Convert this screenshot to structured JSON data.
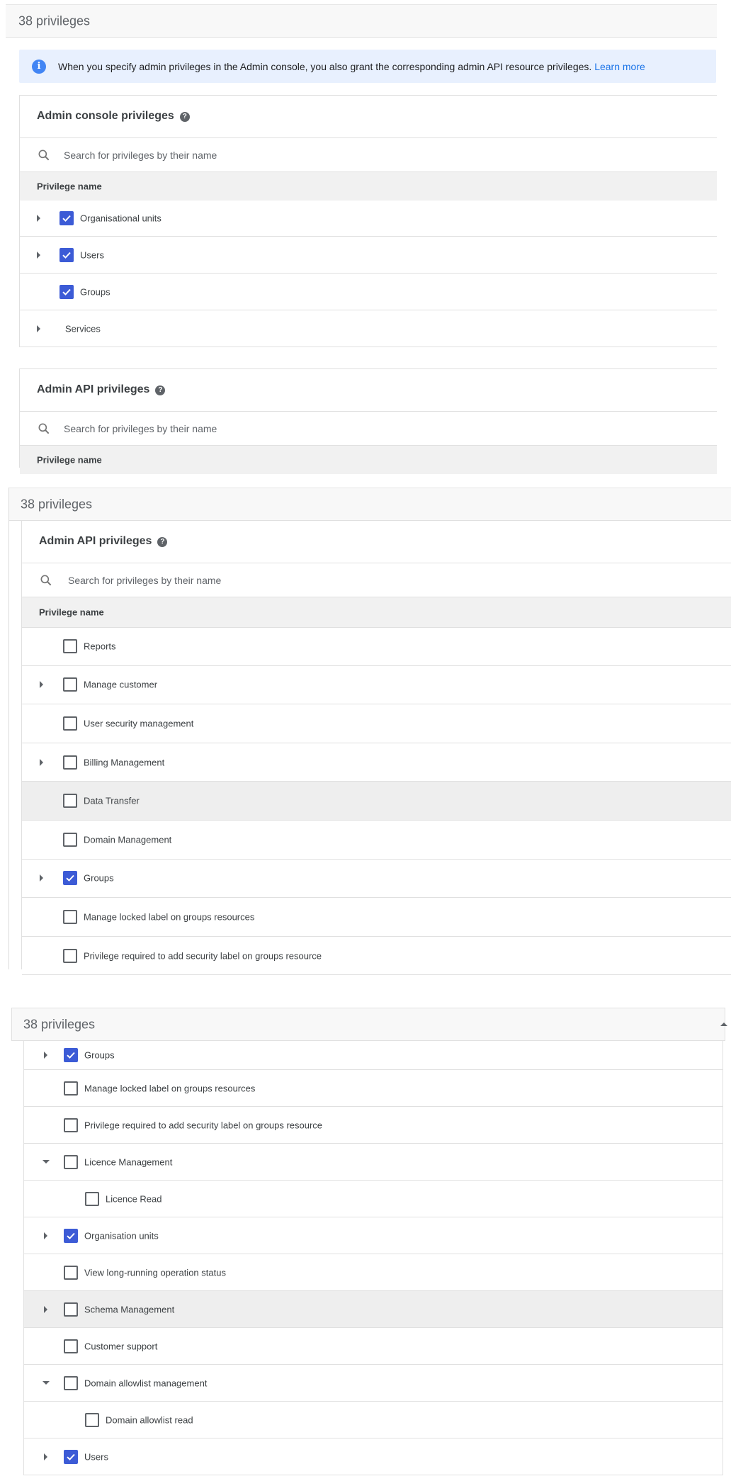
{
  "section1": {
    "header": "38 privileges",
    "info": {
      "message": "When you specify admin privileges in the Admin console, you also grant the corresponding admin API resource privileges.",
      "link": "Learn more"
    },
    "console_card": {
      "title": "Admin console privileges",
      "search_placeholder": "Search for privileges by their name",
      "column": "Privilege name",
      "rows": [
        {
          "label": "Organisational units",
          "caret": "right",
          "checked": true
        },
        {
          "label": "Users",
          "caret": "right",
          "checked": true
        },
        {
          "label": "Groups",
          "caret": "none",
          "checked": true
        },
        {
          "label": "Services",
          "caret": "right",
          "checked": null
        }
      ]
    },
    "api_card": {
      "title": "Admin API privileges",
      "search_placeholder": "Search for privileges by their name",
      "column": "Privilege name"
    }
  },
  "section2": {
    "header": "38 privileges",
    "api_card": {
      "title": "Admin API privileges",
      "search_placeholder": "Search for privileges by their name",
      "column": "Privilege name",
      "rows": [
        {
          "label": "Reports",
          "caret": "none",
          "checked": false
        },
        {
          "label": "Manage customer",
          "caret": "right",
          "checked": false
        },
        {
          "label": "User security management",
          "caret": "none",
          "checked": false
        },
        {
          "label": "Billing Management",
          "caret": "right",
          "checked": false
        },
        {
          "label": "Data Transfer",
          "caret": "none",
          "checked": false,
          "highlight": true
        },
        {
          "label": "Domain Management",
          "caret": "none",
          "checked": false
        },
        {
          "label": "Groups",
          "caret": "right",
          "checked": true
        },
        {
          "label": "Manage locked label on groups resources",
          "caret": "none",
          "checked": false
        },
        {
          "label": "Privilege required to add security label on groups resource",
          "caret": "none",
          "checked": false
        }
      ]
    }
  },
  "section3": {
    "header": "38 privileges",
    "rows": [
      {
        "label": "Groups",
        "caret": "right",
        "checked": true
      },
      {
        "label": "Manage locked label on groups resources",
        "caret": "none",
        "checked": false
      },
      {
        "label": "Privilege required to add security label on groups resource",
        "caret": "none",
        "checked": false
      },
      {
        "label": "Licence Management",
        "caret": "down",
        "checked": false
      },
      {
        "label": "Licence Read",
        "caret": "none",
        "checked": false,
        "indent": 1
      },
      {
        "label": "Organisation units",
        "caret": "right",
        "checked": true
      },
      {
        "label": "View long-running operation status",
        "caret": "none",
        "checked": false
      },
      {
        "label": "Schema Management",
        "caret": "right",
        "checked": false,
        "highlight": true
      },
      {
        "label": "Customer support",
        "caret": "none",
        "checked": false
      },
      {
        "label": "Domain allowlist management",
        "caret": "down",
        "checked": false
      },
      {
        "label": "Domain allowlist read",
        "caret": "none",
        "checked": false,
        "indent": 1
      },
      {
        "label": "Users",
        "caret": "right",
        "checked": true
      }
    ]
  },
  "colors": {
    "accent": "#3c5bd6",
    "link": "#1a73e8",
    "info_bg": "#e8f0fe",
    "header_bg": "#f8f8f8",
    "column_bg": "#f1f1f1",
    "highlight_row": "#eeeeee"
  },
  "icons": {
    "search": "search-icon",
    "help": "help-icon",
    "info": "info-icon",
    "expand": "caret-right-icon",
    "collapse": "caret-down-icon",
    "check": "checkmark-icon"
  }
}
